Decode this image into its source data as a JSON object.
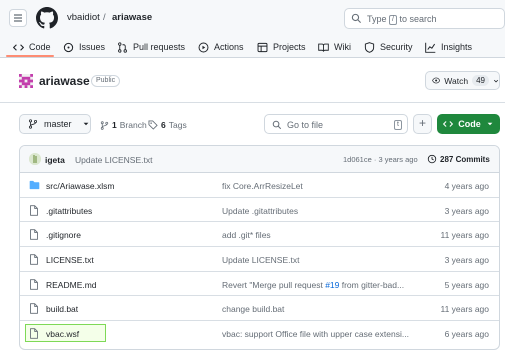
{
  "header": {
    "owner": "vbaidiot",
    "separator": "/",
    "repo": "ariawase",
    "search_text": "Type",
    "search_key": "/",
    "search_suffix": "to search"
  },
  "tabs": [
    {
      "label": "Code",
      "icon": "code-icon"
    },
    {
      "label": "Issues",
      "icon": "issue-icon"
    },
    {
      "label": "Pull requests",
      "icon": "pull-request-icon"
    },
    {
      "label": "Actions",
      "icon": "play-icon"
    },
    {
      "label": "Projects",
      "icon": "table-icon"
    },
    {
      "label": "Wiki",
      "icon": "book-icon"
    },
    {
      "label": "Security",
      "icon": "shield-icon"
    },
    {
      "label": "Insights",
      "icon": "graph-icon"
    }
  ],
  "repo_header": {
    "name": "ariawase",
    "visibility": "Public",
    "watch_label": "Watch",
    "watch_count": "49"
  },
  "toolbar": {
    "branch": "master",
    "branch_count": "1",
    "branch_label": "Branch",
    "tag_count": "6",
    "tag_label": "Tags",
    "goto_placeholder": "Go to file",
    "goto_key": "t",
    "add_label": "+",
    "code_label": "Code"
  },
  "commit": {
    "author": "igeta",
    "message": "Update LICENSE.txt",
    "meta": "1d061ce · 3 years ago",
    "count_label": "287 Commits"
  },
  "files": [
    {
      "name": "src/Ariawase.xlsm",
      "type": "folder",
      "message": "fix Core.ArrResizeLet",
      "age": "4 years ago"
    },
    {
      "name": ".gitattributes",
      "type": "file",
      "message": "Update .gitattributes",
      "age": "3 years ago"
    },
    {
      "name": ".gitignore",
      "type": "file",
      "message": "add .git* files",
      "age": "11 years ago"
    },
    {
      "name": "LICENSE.txt",
      "type": "file",
      "message": "Update LICENSE.txt",
      "age": "3 years ago"
    },
    {
      "name": "README.md",
      "type": "file",
      "message_pre": "Revert \"Merge pull request ",
      "message_link": "#19",
      "message_post": " from gitter-bad...",
      "age": "5 years ago"
    },
    {
      "name": "build.bat",
      "type": "file",
      "message": "change build.bat",
      "age": "11 years ago"
    },
    {
      "name": "vbac.wsf",
      "type": "file",
      "message": "vbac: support Office file with upper case extensi...",
      "age": "6 years ago"
    }
  ],
  "colors": {
    "accent_green": "#1f883d",
    "tab_underline": "#fd8c73",
    "link_blue": "#0969da",
    "folder_blue": "#54aeff",
    "highlight_green": "#7ed957"
  }
}
